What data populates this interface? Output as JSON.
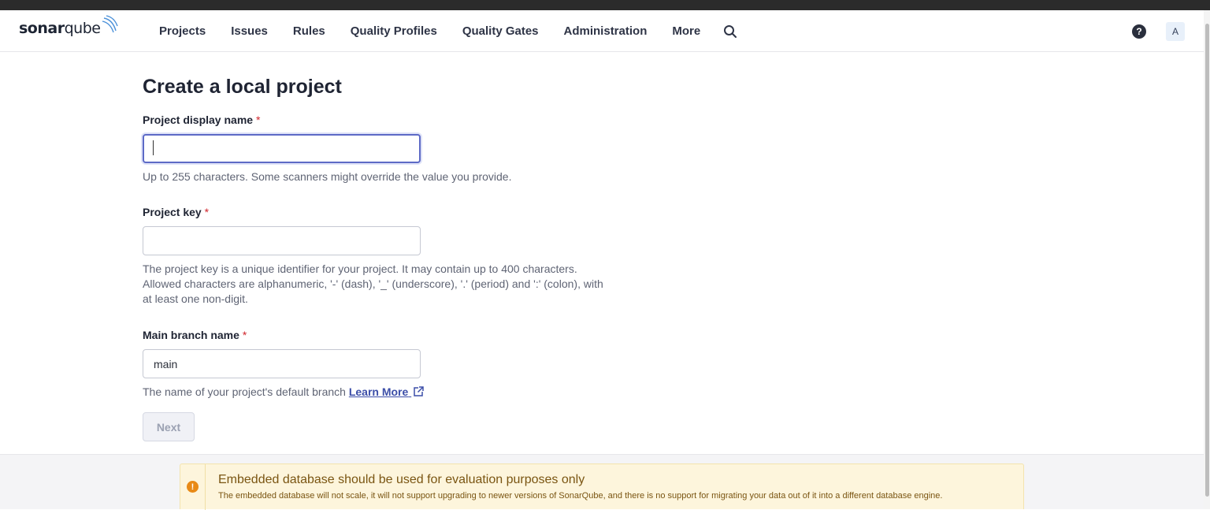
{
  "app": {
    "logo_bold": "sonar",
    "logo_light": "qube"
  },
  "nav": {
    "items": [
      "Projects",
      "Issues",
      "Rules",
      "Quality Profiles",
      "Quality Gates",
      "Administration",
      "More"
    ],
    "search_icon": "search-icon",
    "help_icon": "help-icon",
    "avatar_letter": "A"
  },
  "page": {
    "title": "Create a local project"
  },
  "form": {
    "display_name": {
      "label": "Project display name",
      "required_mark": "*",
      "value": "",
      "help": "Up to 255 characters. Some scanners might override the value you provide."
    },
    "project_key": {
      "label": "Project key",
      "required_mark": "*",
      "value": "",
      "help": "The project key is a unique identifier for your project. It may contain up to 400 characters. Allowed characters are alphanumeric, '-' (dash), '_' (underscore), '.' (period) and ':' (colon), with at least one non-digit."
    },
    "main_branch": {
      "label": "Main branch name",
      "required_mark": "*",
      "value": "main",
      "help": "The name of your project's default branch",
      "link_label": "Learn More"
    },
    "next_label": "Next"
  },
  "warning": {
    "icon": "warning-icon",
    "title": "Embedded database should be used for evaluation purposes only",
    "text": "The embedded database will not scale, it will not support upgrading to newer versions of SonarQube, and there is no support for migrating your data out of it into a different database engine.",
    "color": "#e88a16"
  }
}
